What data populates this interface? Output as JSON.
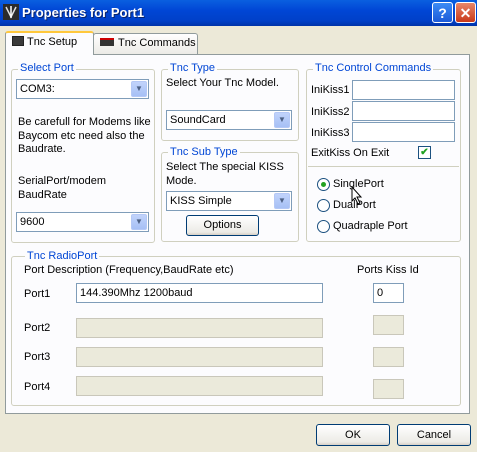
{
  "window": {
    "title": "Properties for Port1",
    "help_label": "?",
    "close_label": "✕"
  },
  "tabs": [
    {
      "label": "Tnc Setup"
    },
    {
      "label": "Tnc Commands"
    }
  ],
  "select_port": {
    "title": "Select Port",
    "port_value": "COM3:",
    "note": [
      "Be carefull for Modems like",
      "Baycom etc need also the",
      "Baudrate."
    ],
    "baud_label": [
      "SerialPort/modem",
      "BaudRate"
    ],
    "baud_value": "9600"
  },
  "tnc_type": {
    "title": "Tnc Type",
    "prompt": "Select Your Tnc Model.",
    "value": "SoundCard"
  },
  "tnc_sub_type": {
    "title": "Tnc Sub Type",
    "prompt": [
      "Select The special KISS",
      "Mode."
    ],
    "value": "KISS Simple",
    "options_label": "Options"
  },
  "control_commands": {
    "title": "Tnc Control Commands",
    "fields": [
      {
        "label": "IniKiss1",
        "value": ""
      },
      {
        "label": "IniKiss2",
        "value": ""
      },
      {
        "label": "IniKiss3",
        "value": ""
      }
    ],
    "exit_label": "ExitKiss On Exit",
    "exit_checked": true,
    "radios": [
      {
        "label": "SinglePort",
        "selected": true
      },
      {
        "label": "DualPort",
        "selected": false
      },
      {
        "label": "Quadraple Port",
        "selected": false
      }
    ]
  },
  "radio_port": {
    "title": "Tnc RadioPort",
    "desc_header": "Port Description (Frequency,BaudRate etc)",
    "kiss_header": "Ports Kiss Id",
    "ports": [
      {
        "label": "Port1",
        "description": "144.390Mhz 1200baud",
        "kiss_id": "0"
      },
      {
        "label": "Port2",
        "description": "",
        "kiss_id": ""
      },
      {
        "label": "Port3",
        "description": "",
        "kiss_id": ""
      },
      {
        "label": "Port4",
        "description": "",
        "kiss_id": ""
      }
    ]
  },
  "buttons": {
    "ok": "OK",
    "cancel": "Cancel"
  },
  "icons": {
    "app": "antenna-icon",
    "tab_setup": "tnc-setup-icon",
    "tab_commands": "tnc-commands-icon",
    "dropdown": "chevron-down-icon",
    "cursor": "mouse-pointer-icon"
  }
}
